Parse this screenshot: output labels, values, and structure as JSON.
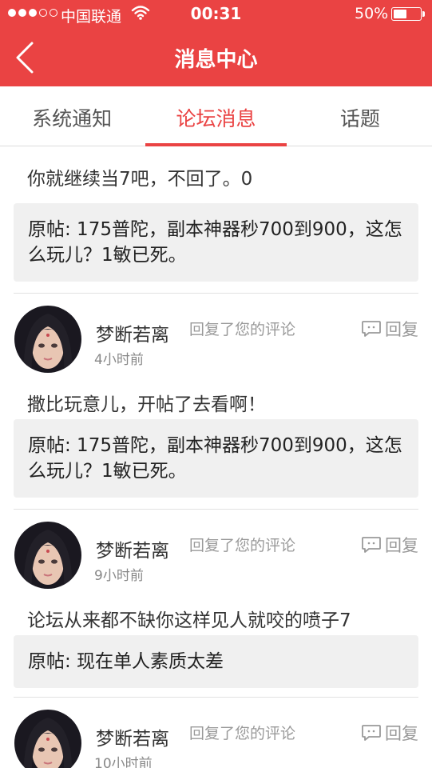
{
  "status_bar": {
    "carrier": "中国联通",
    "time": "00:31",
    "battery_percent": "50%",
    "battery_level": 0.5
  },
  "nav": {
    "title": "消息中心"
  },
  "tabs": [
    {
      "label": "系统通知"
    },
    {
      "label": "论坛消息"
    },
    {
      "label": "话题"
    }
  ],
  "messages": [
    {
      "username": "",
      "action": "",
      "time": "",
      "reply_label": "",
      "text": "你就继续当7吧，不回了。0",
      "original": "原帖: 175普陀，副本神器秒700到900，这怎么玩儿？1敏已死。"
    },
    {
      "username": "梦断若离",
      "action": "回复了您的评论",
      "time": "4小时前",
      "reply_label": "回复",
      "text": "撒比玩意儿，开帖了去看啊！",
      "original": "原帖: 175普陀，副本神器秒700到900，这怎么玩儿？1敏已死。"
    },
    {
      "username": "梦断若离",
      "action": "回复了您的评论",
      "time": "9小时前",
      "reply_label": "回复",
      "text": "论坛从来都不缺你这样见人就咬的喷子7",
      "original": "原帖: 现在单人素质太差"
    },
    {
      "username": "梦断若离",
      "action": "回复了您的评论",
      "time": "10小时前",
      "reply_label": "回复",
      "text": "",
      "original": ""
    }
  ]
}
